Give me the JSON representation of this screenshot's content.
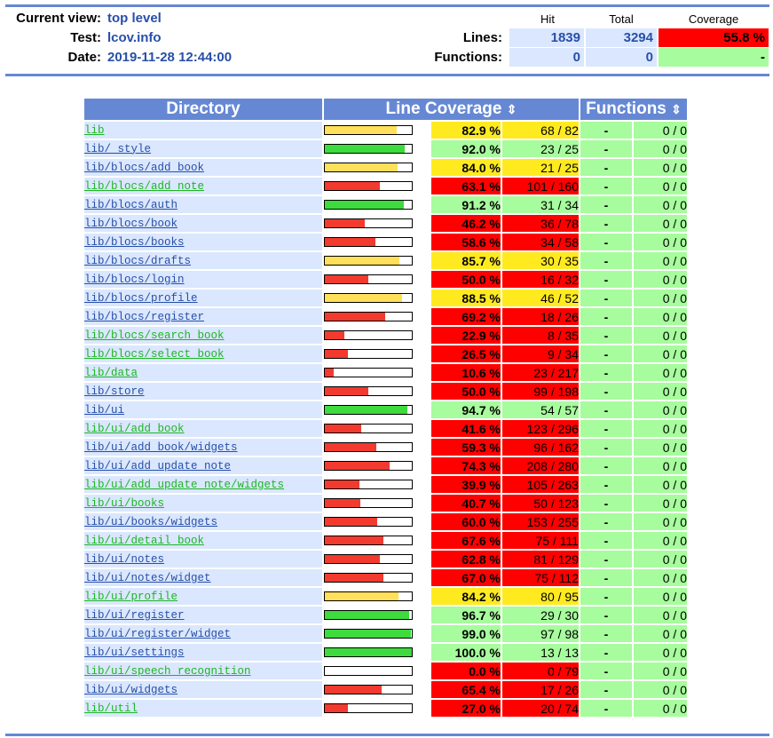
{
  "header": {
    "current_view_label": "Current view:",
    "current_view_value": "top level",
    "test_label": "Test:",
    "test_value": "lcov.info",
    "date_label": "Date:",
    "date_value": "2019-11-28 12:44:00",
    "col_hit": "Hit",
    "col_total": "Total",
    "col_coverage": "Coverage",
    "lines_label": "Lines:",
    "lines_hit": "1839",
    "lines_total": "3294",
    "lines_coverage": "55.8 %",
    "functions_label": "Functions:",
    "functions_hit": "0",
    "functions_total": "0",
    "functions_coverage": "-"
  },
  "table": {
    "col_directory": "Directory",
    "col_line_coverage": "Line Coverage",
    "col_functions": "Functions",
    "sort_icon": "⇕",
    "rows": [
      {
        "dir": "lib",
        "rate": 82.9,
        "pct": "82.9 %",
        "lines": "68 / 82",
        "level": "med",
        "fpct": "-",
        "fnum": "0 / 0",
        "link": "green"
      },
      {
        "dir": "lib/_style",
        "rate": 92.0,
        "pct": "92.0 %",
        "lines": "23 / 25",
        "level": "hi",
        "fpct": "-",
        "fnum": "0 / 0",
        "link": "blue"
      },
      {
        "dir": "lib/blocs/add_book",
        "rate": 84.0,
        "pct": "84.0 %",
        "lines": "21 / 25",
        "level": "med",
        "fpct": "-",
        "fnum": "0 / 0",
        "link": "blue"
      },
      {
        "dir": "lib/blocs/add_note",
        "rate": 63.1,
        "pct": "63.1 %",
        "lines": "101 / 160",
        "level": "lo",
        "fpct": "-",
        "fnum": "0 / 0",
        "link": "green"
      },
      {
        "dir": "lib/blocs/auth",
        "rate": 91.2,
        "pct": "91.2 %",
        "lines": "31 / 34",
        "level": "hi",
        "fpct": "-",
        "fnum": "0 / 0",
        "link": "blue"
      },
      {
        "dir": "lib/blocs/book",
        "rate": 46.2,
        "pct": "46.2 %",
        "lines": "36 / 78",
        "level": "lo",
        "fpct": "-",
        "fnum": "0 / 0",
        "link": "blue"
      },
      {
        "dir": "lib/blocs/books",
        "rate": 58.6,
        "pct": "58.6 %",
        "lines": "34 / 58",
        "level": "lo",
        "fpct": "-",
        "fnum": "0 / 0",
        "link": "blue"
      },
      {
        "dir": "lib/blocs/drafts",
        "rate": 85.7,
        "pct": "85.7 %",
        "lines": "30 / 35",
        "level": "med",
        "fpct": "-",
        "fnum": "0 / 0",
        "link": "blue"
      },
      {
        "dir": "lib/blocs/login",
        "rate": 50.0,
        "pct": "50.0 %",
        "lines": "16 / 32",
        "level": "lo",
        "fpct": "-",
        "fnum": "0 / 0",
        "link": "blue"
      },
      {
        "dir": "lib/blocs/profile",
        "rate": 88.5,
        "pct": "88.5 %",
        "lines": "46 / 52",
        "level": "med",
        "fpct": "-",
        "fnum": "0 / 0",
        "link": "blue"
      },
      {
        "dir": "lib/blocs/register",
        "rate": 69.2,
        "pct": "69.2 %",
        "lines": "18 / 26",
        "level": "lo",
        "fpct": "-",
        "fnum": "0 / 0",
        "link": "blue"
      },
      {
        "dir": "lib/blocs/search_book",
        "rate": 22.9,
        "pct": "22.9 %",
        "lines": "8 / 35",
        "level": "lo",
        "fpct": "-",
        "fnum": "0 / 0",
        "link": "green"
      },
      {
        "dir": "lib/blocs/select_book",
        "rate": 26.5,
        "pct": "26.5 %",
        "lines": "9 / 34",
        "level": "lo",
        "fpct": "-",
        "fnum": "0 / 0",
        "link": "green"
      },
      {
        "dir": "lib/data",
        "rate": 10.6,
        "pct": "10.6 %",
        "lines": "23 / 217",
        "level": "lo",
        "fpct": "-",
        "fnum": "0 / 0",
        "link": "green"
      },
      {
        "dir": "lib/store",
        "rate": 50.0,
        "pct": "50.0 %",
        "lines": "99 / 198",
        "level": "lo",
        "fpct": "-",
        "fnum": "0 / 0",
        "link": "blue"
      },
      {
        "dir": "lib/ui",
        "rate": 94.7,
        "pct": "94.7 %",
        "lines": "54 / 57",
        "level": "hi",
        "fpct": "-",
        "fnum": "0 / 0",
        "link": "blue"
      },
      {
        "dir": "lib/ui/add_book",
        "rate": 41.6,
        "pct": "41.6 %",
        "lines": "123 / 296",
        "level": "lo",
        "fpct": "-",
        "fnum": "0 / 0",
        "link": "green"
      },
      {
        "dir": "lib/ui/add_book/widgets",
        "rate": 59.3,
        "pct": "59.3 %",
        "lines": "96 / 162",
        "level": "lo",
        "fpct": "-",
        "fnum": "0 / 0",
        "link": "blue"
      },
      {
        "dir": "lib/ui/add_update_note",
        "rate": 74.3,
        "pct": "74.3 %",
        "lines": "208 / 280",
        "level": "lo",
        "fpct": "-",
        "fnum": "0 / 0",
        "link": "blue"
      },
      {
        "dir": "lib/ui/add_update_note/widgets",
        "rate": 39.9,
        "pct": "39.9 %",
        "lines": "105 / 263",
        "level": "lo",
        "fpct": "-",
        "fnum": "0 / 0",
        "link": "green"
      },
      {
        "dir": "lib/ui/books",
        "rate": 40.7,
        "pct": "40.7 %",
        "lines": "50 / 123",
        "level": "lo",
        "fpct": "-",
        "fnum": "0 / 0",
        "link": "green"
      },
      {
        "dir": "lib/ui/books/widgets",
        "rate": 60.0,
        "pct": "60.0 %",
        "lines": "153 / 255",
        "level": "lo",
        "fpct": "-",
        "fnum": "0 / 0",
        "link": "blue"
      },
      {
        "dir": "lib/ui/detail_book",
        "rate": 67.6,
        "pct": "67.6 %",
        "lines": "75 / 111",
        "level": "lo",
        "fpct": "-",
        "fnum": "0 / 0",
        "link": "green"
      },
      {
        "dir": "lib/ui/notes",
        "rate": 62.8,
        "pct": "62.8 %",
        "lines": "81 / 129",
        "level": "lo",
        "fpct": "-",
        "fnum": "0 / 0",
        "link": "blue"
      },
      {
        "dir": "lib/ui/notes/widget",
        "rate": 67.0,
        "pct": "67.0 %",
        "lines": "75 / 112",
        "level": "lo",
        "fpct": "-",
        "fnum": "0 / 0",
        "link": "blue"
      },
      {
        "dir": "lib/ui/profile",
        "rate": 84.2,
        "pct": "84.2 %",
        "lines": "80 / 95",
        "level": "med",
        "fpct": "-",
        "fnum": "0 / 0",
        "link": "green"
      },
      {
        "dir": "lib/ui/register",
        "rate": 96.7,
        "pct": "96.7 %",
        "lines": "29 / 30",
        "level": "hi",
        "fpct": "-",
        "fnum": "0 / 0",
        "link": "blue"
      },
      {
        "dir": "lib/ui/register/widget",
        "rate": 99.0,
        "pct": "99.0 %",
        "lines": "97 / 98",
        "level": "hi",
        "fpct": "-",
        "fnum": "0 / 0",
        "link": "blue"
      },
      {
        "dir": "lib/ui/settings",
        "rate": 100.0,
        "pct": "100.0 %",
        "lines": "13 / 13",
        "level": "hi",
        "fpct": "-",
        "fnum": "0 / 0",
        "link": "blue"
      },
      {
        "dir": "lib/ui/speech_recognition",
        "rate": 0.0,
        "pct": "0.0 %",
        "lines": "0 / 79",
        "level": "lo",
        "fpct": "-",
        "fnum": "0 / 0",
        "link": "green"
      },
      {
        "dir": "lib/ui/widgets",
        "rate": 65.4,
        "pct": "65.4 %",
        "lines": "17 / 26",
        "level": "lo",
        "fpct": "-",
        "fnum": "0 / 0",
        "link": "blue"
      },
      {
        "dir": "lib/util",
        "rate": 27.0,
        "pct": "27.0 %",
        "lines": "20 / 74",
        "level": "lo",
        "fpct": "-",
        "fnum": "0 / 0",
        "link": "green"
      }
    ]
  },
  "colors": {
    "hi": "#a7fc9d",
    "med": "#ffea20",
    "lo": "#ff0000",
    "bar_hi": "#3ddb3d",
    "bar_med": "#ffe05a",
    "bar_lo": "#f23a2f",
    "link_blue": "#284fa8",
    "link_green": "#1db624",
    "header_bg": "#6688d4",
    "entry_bg": "#dae7fe"
  }
}
